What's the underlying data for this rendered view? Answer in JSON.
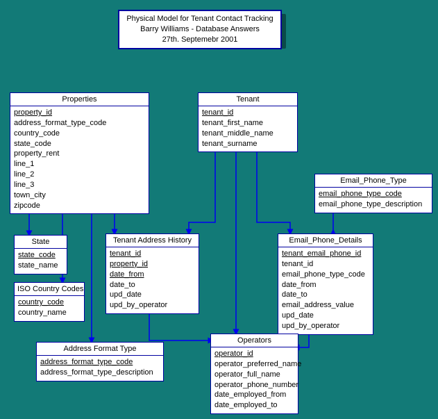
{
  "title": {
    "line1": "Physical Model for Tenant Contact Tracking",
    "line2": "Barry Williams - Database Answers",
    "line3": "27th. Septemebr 2001"
  },
  "entities": {
    "properties": {
      "name": "Properties",
      "fields": [
        {
          "name": "property_id",
          "pk": true
        },
        {
          "name": "address_format_type_code",
          "pk": false
        },
        {
          "name": "country_code",
          "pk": false
        },
        {
          "name": "state_code",
          "pk": false
        },
        {
          "name": "property_rent",
          "pk": false
        },
        {
          "name": "line_1",
          "pk": false
        },
        {
          "name": "line_2",
          "pk": false
        },
        {
          "name": "line_3",
          "pk": false
        },
        {
          "name": "town_city",
          "pk": false
        },
        {
          "name": "zipcode",
          "pk": false
        }
      ]
    },
    "tenant": {
      "name": "Tenant",
      "fields": [
        {
          "name": "tenant_id",
          "pk": true
        },
        {
          "name": "tenant_first_name",
          "pk": false
        },
        {
          "name": "tenant_middle_name",
          "pk": false
        },
        {
          "name": "tenant_surname",
          "pk": false
        }
      ]
    },
    "email_phone_type": {
      "name": "Email_Phone_Type",
      "fields": [
        {
          "name": "email_phone_type_code",
          "pk": true
        },
        {
          "name": "email_phone_type_description",
          "pk": false
        }
      ]
    },
    "state": {
      "name": "State",
      "fields": [
        {
          "name": "state_code",
          "pk": true
        },
        {
          "name": "state_name",
          "pk": false
        }
      ]
    },
    "tenant_address_history": {
      "name": "Tenant Address History",
      "fields": [
        {
          "name": "tenant_id",
          "pk": true
        },
        {
          "name": "property_id",
          "pk": true
        },
        {
          "name": "date_from",
          "pk": true
        },
        {
          "name": "date_to",
          "pk": false
        },
        {
          "name": "upd_date",
          "pk": false
        },
        {
          "name": "upd_by_operator",
          "pk": false
        }
      ]
    },
    "email_phone_details": {
      "name": "Email_Phone_Details",
      "fields": [
        {
          "name": "tenant_email_phone_id",
          "pk": true
        },
        {
          "name": "tenant_id",
          "pk": false
        },
        {
          "name": "email_phone_type_code",
          "pk": false
        },
        {
          "name": "date_from",
          "pk": false
        },
        {
          "name": "date_to",
          "pk": false
        },
        {
          "name": "email_address_value",
          "pk": false
        },
        {
          "name": "upd_date",
          "pk": false
        },
        {
          "name": "upd_by_operator",
          "pk": false
        }
      ]
    },
    "iso_country_codes": {
      "name": "ISO Country Codes",
      "fields": [
        {
          "name": "country_code",
          "pk": true
        },
        {
          "name": "country_name",
          "pk": false
        }
      ]
    },
    "address_format_type": {
      "name": "Address Format Type",
      "fields": [
        {
          "name": "address_format_type_code",
          "pk": true
        },
        {
          "name": "address_format_type_description",
          "pk": false
        }
      ]
    },
    "operators": {
      "name": "Operators",
      "fields": [
        {
          "name": "operator_id",
          "pk": true
        },
        {
          "name": "operator_preferred_name",
          "pk": false
        },
        {
          "name": "operator_full_name",
          "pk": false
        },
        {
          "name": "operator_phone_number",
          "pk": false
        },
        {
          "name": "date_employed_from",
          "pk": false
        },
        {
          "name": "date_employed_to",
          "pk": false
        }
      ]
    }
  }
}
